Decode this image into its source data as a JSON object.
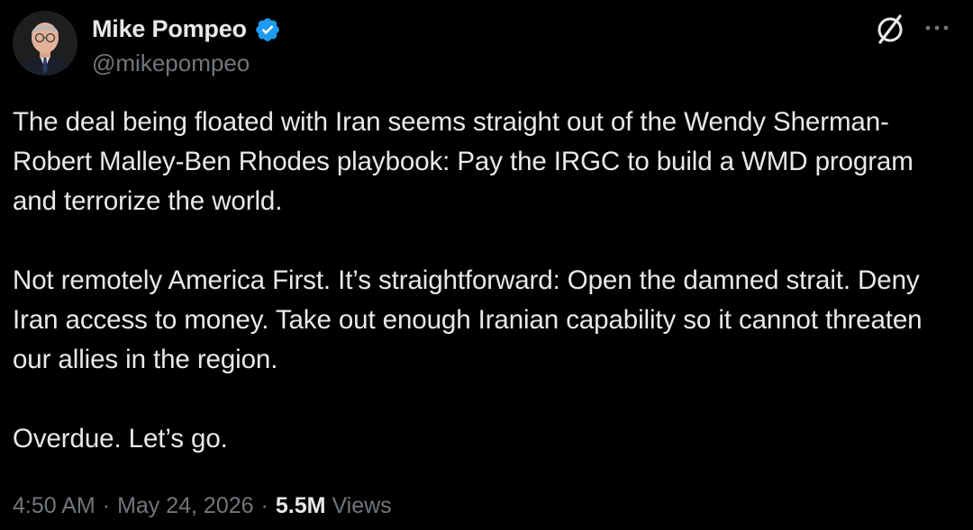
{
  "author": {
    "display_name": "Mike Pompeo",
    "handle": "@mikepompeo",
    "verified": true
  },
  "tweet": {
    "paragraphs": [
      "The deal being floated with Iran seems straight out of the Wendy Sherman-Robert Malley-Ben Rhodes playbook: Pay the IRGC to build a WMD program and terrorize the world.",
      "Not remotely America First. It’s straightforward: Open the damned strait. Deny Iran access to money. Take out enough Iranian capability so it cannot threaten our allies in the region.",
      "Overdue. Let’s go."
    ]
  },
  "meta": {
    "time": "4:50 AM",
    "separator": "·",
    "date": "May 24, 2026",
    "views_count": "5.5M",
    "views_label": "Views"
  },
  "icons": {
    "verified": "verified-badge-icon",
    "grok": "grok-icon",
    "more": "more-options-icon"
  },
  "colors": {
    "background": "#000000",
    "text": "#e7e9ea",
    "muted": "#71767b",
    "verified": "#1d9bf0"
  }
}
